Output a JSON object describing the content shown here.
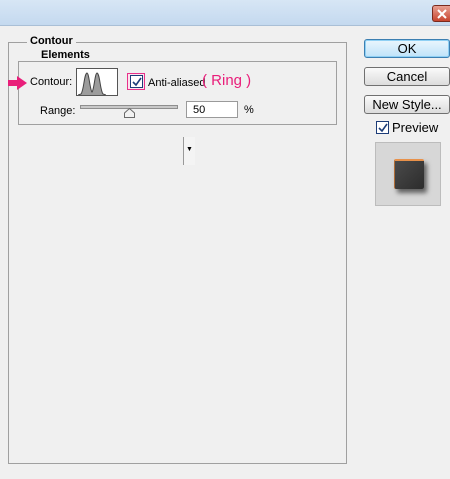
{
  "dialog": {
    "panel_title": "Contour",
    "group_title": "Elements"
  },
  "contour": {
    "label": "Contour:",
    "anti_aliased_label": "Anti-aliased",
    "anti_aliased_checked": true,
    "annotation": "( Ring )",
    "annotation_color": "#e91e7a"
  },
  "range": {
    "label": "Range:",
    "value": "50",
    "unit": "%",
    "slider_level": 50
  },
  "buttons": {
    "ok": "OK",
    "cancel": "Cancel",
    "new_style": "New Style..."
  },
  "preview": {
    "label": "Preview",
    "checked": true
  },
  "icons": [
    "close-icon",
    "pointer-arrow-icon",
    "contour-curve-icon",
    "dropdown-arrow-icon",
    "checkmark-icon",
    "slider-thumb-icon"
  ]
}
